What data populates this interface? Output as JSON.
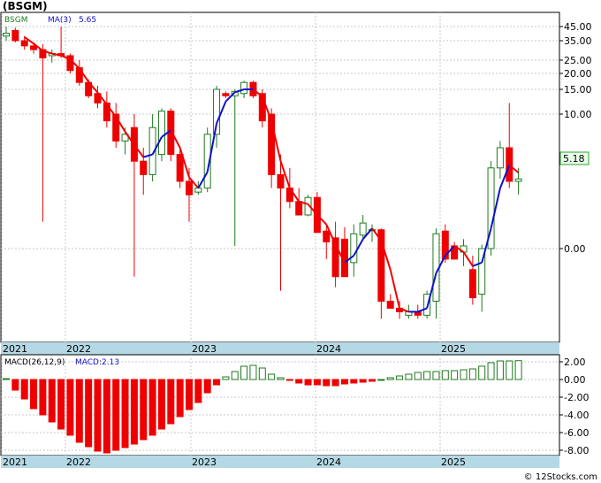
{
  "title": "(BSGM)",
  "watermark": "© 12Stocks.com",
  "colors": {
    "up": "#1f7a1f",
    "down": "#ee0000",
    "ma_down": "#ee0000",
    "ma_up": "#1010cc",
    "macd_pos": "#1f7a1f",
    "macd_neg": "#ee0000",
    "timebar": "#b4d8e4",
    "grid": "#c8c8c8",
    "price_box": "#2ea02e"
  },
  "price_panel": {
    "legend_symbol": "BSGM",
    "legend_ma_label": "MA(3)",
    "legend_ma_value": "5.65",
    "last_price_label": "5.18",
    "y_ticks": [
      "45.00",
      "35.00",
      "25.00",
      "20.00",
      "15.00",
      "10.00",
      "0.00"
    ]
  },
  "macd_panel": {
    "label": "MACD(26,12,9)",
    "value_label": "MACD:2.13",
    "y_ticks": [
      "2.00",
      "0.00",
      "-2.00",
      "-4.00",
      "-6.00",
      "-8.00"
    ]
  },
  "time_axis": {
    "labels": [
      "2021",
      "2022",
      "2023",
      "2024",
      "2025"
    ]
  },
  "chart_data": {
    "type": "candlestick",
    "title": "(BSGM)",
    "interval": "monthly",
    "y_scale": "log",
    "ylim": [
      -2,
      50
    ],
    "series_ma": {
      "name": "MA(3)",
      "last": 5.65
    },
    "candles": [
      {
        "o": 38,
        "h": 45,
        "l": 35,
        "c": 40
      },
      {
        "o": 42,
        "h": 44,
        "l": 34,
        "c": 35
      },
      {
        "o": 35,
        "h": 38,
        "l": 30,
        "c": 32
      },
      {
        "o": 32,
        "h": 34,
        "l": 28,
        "c": 30
      },
      {
        "o": 30,
        "h": 33,
        "l": 2.0,
        "c": 26
      },
      {
        "o": 27,
        "h": 30,
        "l": 24,
        "c": 28
      },
      {
        "o": 28,
        "h": 45,
        "l": 26,
        "c": 27
      },
      {
        "o": 27,
        "h": 28,
        "l": 20,
        "c": 21
      },
      {
        "o": 22,
        "h": 25,
        "l": 16,
        "c": 17
      },
      {
        "o": 17,
        "h": 18,
        "l": 13,
        "c": 13.5
      },
      {
        "o": 14,
        "h": 16,
        "l": 11,
        "c": 12
      },
      {
        "o": 12,
        "h": 14.5,
        "l": 9,
        "c": 9.5
      },
      {
        "o": 10,
        "h": 12,
        "l": 7.5,
        "c": 8
      },
      {
        "o": 8,
        "h": 9,
        "l": 7,
        "c": 8.5
      },
      {
        "o": 9,
        "h": 10,
        "l": -0.8,
        "c": 6.5
      },
      {
        "o": 6.5,
        "h": 7.5,
        "l": 4.0,
        "c": 5.5
      },
      {
        "o": 5.5,
        "h": 10,
        "l": 5,
        "c": 9
      },
      {
        "o": 7,
        "h": 11,
        "l": 6.5,
        "c": 10.5
      },
      {
        "o": 10.5,
        "h": 11,
        "l": 6.5,
        "c": 7
      },
      {
        "o": 7,
        "h": 7.5,
        "l": 4.5,
        "c": 5
      },
      {
        "o": 5,
        "h": 6,
        "l": 2,
        "c": 4
      },
      {
        "o": 4.2,
        "h": 5,
        "l": 4,
        "c": 4.5
      },
      {
        "o": 4.5,
        "h": 9,
        "l": 4.2,
        "c": 8.5
      },
      {
        "o": 8.5,
        "h": 16,
        "l": 7.5,
        "c": 15
      },
      {
        "o": 14,
        "h": 14.5,
        "l": 13,
        "c": 13.5
      },
      {
        "o": 13.5,
        "h": 15,
        "l": 0.2,
        "c": 14.5
      },
      {
        "o": 14,
        "h": 17.5,
        "l": 13,
        "c": 17
      },
      {
        "o": 17,
        "h": 17.5,
        "l": 13,
        "c": 13.5
      },
      {
        "o": 14,
        "h": 15,
        "l": 9,
        "c": 9.5
      },
      {
        "o": 10,
        "h": 11,
        "l": 4.5,
        "c": 5.5
      },
      {
        "o": 5.5,
        "h": 7,
        "l": -1.2,
        "c": 4.5
      },
      {
        "o": 4.5,
        "h": 6,
        "l": 3,
        "c": 3.5
      },
      {
        "o": 3.5,
        "h": 4.5,
        "l": 2.5,
        "c": 2.5
      },
      {
        "o": 2.5,
        "h": 4,
        "l": 2.4,
        "c": 3.8
      },
      {
        "o": 3.8,
        "h": 4.2,
        "l": 1.2,
        "c": 1.2
      },
      {
        "o": 1.3,
        "h": 1.7,
        "l": -0.3,
        "c": 0.5
      },
      {
        "o": 0.8,
        "h": 2,
        "l": -1.1,
        "c": -0.8
      },
      {
        "o": 0.7,
        "h": 1.6,
        "l": -0.2,
        "c": -0.8
      },
      {
        "o": -0.4,
        "h": 1.8,
        "l": -0.8,
        "c": 1.1
      },
      {
        "o": 1.0,
        "h": 2.5,
        "l": 0.7,
        "c": 1.9
      },
      {
        "o": 1.4,
        "h": 1.8,
        "l": 0.5,
        "c": 1.4
      },
      {
        "o": 1.4,
        "h": 1.5,
        "l": -2.0,
        "c": -1.5
      },
      {
        "o": -1.5,
        "h": -1.3,
        "l": -1.7,
        "c": -1.7
      },
      {
        "o": -1.7,
        "h": -1.5,
        "l": -2.0,
        "c": -1.8
      },
      {
        "o": -1.9,
        "h": -1.6,
        "l": -2.0,
        "c": -1.8
      },
      {
        "o": -1.8,
        "h": -1.6,
        "l": -2.0,
        "c": -1.9
      },
      {
        "o": -1.9,
        "h": -1.2,
        "l": -2.0,
        "c": -1.3
      },
      {
        "o": -1.5,
        "h": 1.5,
        "l": -2.0,
        "c": 1.1
      },
      {
        "o": 1.3,
        "h": 1.8,
        "l": -0.4,
        "c": -0.3
      },
      {
        "o": 0.2,
        "h": 0.5,
        "l": -0.3,
        "c": -0.3
      },
      {
        "o": -0.1,
        "h": 0.7,
        "l": -0.5,
        "c": 0.2
      },
      {
        "o": -0.6,
        "h": -0.2,
        "l": -1.6,
        "c": -1.4
      },
      {
        "o": -1.3,
        "h": 0.3,
        "l": -1.8,
        "c": 0
      },
      {
        "o": 0,
        "h": 6.5,
        "l": -0.2,
        "c": 6
      },
      {
        "o": 6,
        "h": 8,
        "l": 5.2,
        "c": 7.5
      },
      {
        "o": 7.5,
        "h": 12,
        "l": 4.5,
        "c": 5
      },
      {
        "o": 5,
        "h": 6,
        "l": 4,
        "c": 5.18
      }
    ],
    "ma_line": [
      null,
      null,
      37.3,
      33.3,
      29.4,
      28.0,
      27.1,
      25.3,
      21.7,
      17.2,
      14.2,
      11.7,
      9.8,
      8.7,
      7.7,
      6.8,
      7.0,
      8.3,
      8.8,
      7.5,
      5.3,
      4.5,
      5.7,
      9.3,
      12.3,
      14.3,
      15.0,
      15.0,
      13.3,
      9.5,
      6.5,
      4.5,
      3.5,
      3.3,
      2.5,
      1.8,
      0.3,
      -0.4,
      -0.2,
      0.7,
      1.5,
      0.6,
      -0.6,
      -1.7,
      -1.8,
      -1.8,
      -1.7,
      -0.7,
      -0.2,
      0.2,
      -0.1,
      -0.5,
      -0.4,
      1.5,
      4.5,
      6.2,
      5.65
    ],
    "macd_histogram": [
      0.1,
      -1.2,
      -2.2,
      -3.3,
      -4.0,
      -4.8,
      -5.6,
      -6.3,
      -7.1,
      -7.6,
      -8.1,
      -8.3,
      -8.0,
      -7.7,
      -7.3,
      -6.8,
      -6.3,
      -5.6,
      -5.0,
      -4.2,
      -3.4,
      -2.6,
      -1.5,
      -0.6,
      0.3,
      0.9,
      1.5,
      1.6,
      1.3,
      0.6,
      0.2,
      -0.1,
      -0.4,
      -0.6,
      -0.6,
      -0.7,
      -0.7,
      -0.5,
      -0.4,
      -0.3,
      -0.2,
      0.0,
      0.2,
      0.4,
      0.6,
      0.8,
      0.9,
      0.9,
      1.0,
      1.0,
      1.1,
      1.2,
      1.5,
      1.9,
      2.1,
      2.1,
      2.13
    ],
    "macd_ylim": [
      -8.5,
      2.5
    ],
    "x_labels": [
      "2021",
      "2022",
      "2023",
      "2024",
      "2025"
    ]
  }
}
